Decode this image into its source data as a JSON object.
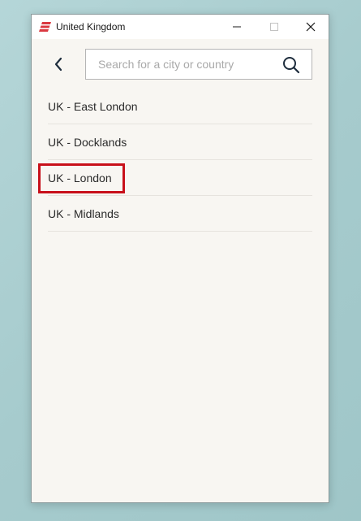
{
  "window": {
    "title": "United Kingdom",
    "controls": {
      "minimize": "minimize",
      "maximize": "maximize",
      "close": "close"
    }
  },
  "search": {
    "placeholder": "Search for a city or country",
    "value": ""
  },
  "locations": [
    {
      "label": "UK - East London"
    },
    {
      "label": "UK - Docklands"
    },
    {
      "label": "UK - London",
      "highlighted": true
    },
    {
      "label": "UK - Midlands"
    }
  ],
  "colors": {
    "brand": "#da3940",
    "highlight": "#c8101a",
    "accent_dark": "#1e2d3d"
  }
}
